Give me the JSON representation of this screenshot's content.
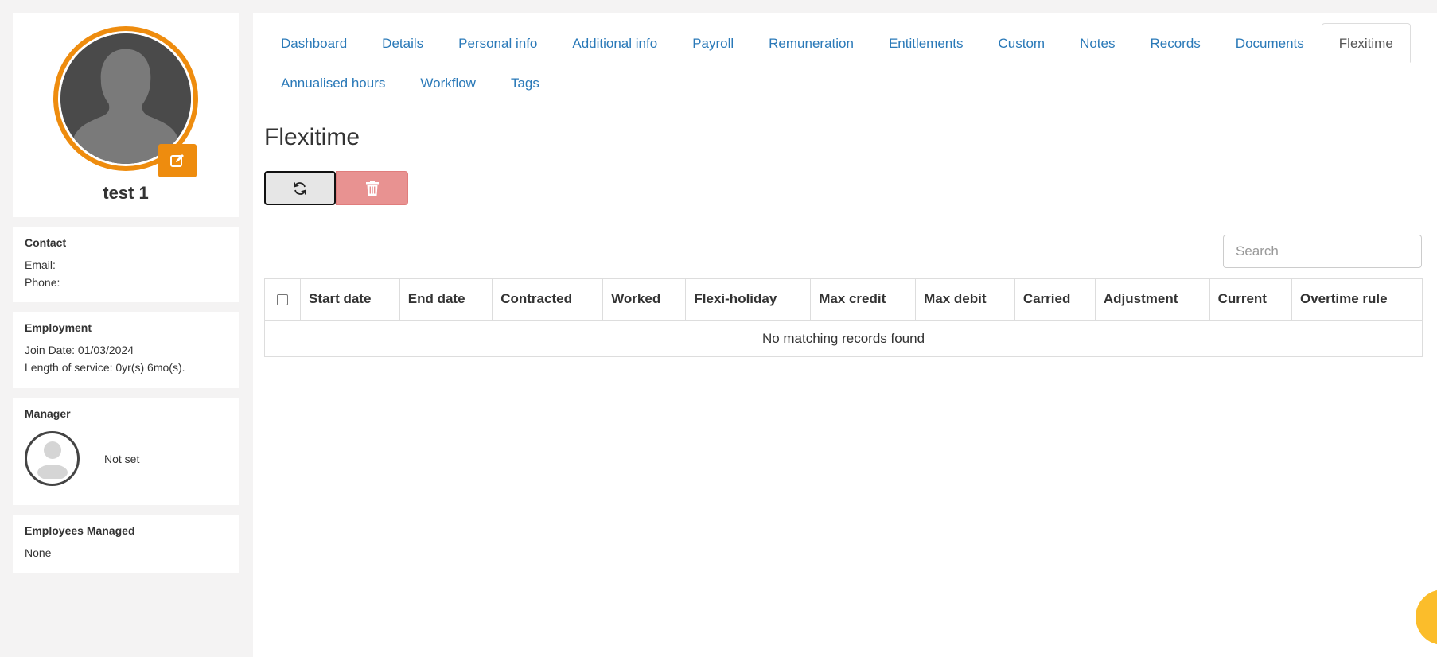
{
  "profile": {
    "name": "test 1"
  },
  "contact": {
    "title": "Contact",
    "email_label": "Email:",
    "phone_label": "Phone:"
  },
  "employment": {
    "title": "Employment",
    "join_date": "Join Date: 01/03/2024",
    "length_of_service": "Length of service: 0yr(s) 6mo(s)."
  },
  "manager": {
    "title": "Manager",
    "name": "Not set"
  },
  "employees_managed": {
    "title": "Employees Managed",
    "value": "None"
  },
  "tabs": [
    {
      "label": "Dashboard",
      "active": false
    },
    {
      "label": "Details",
      "active": false
    },
    {
      "label": "Personal info",
      "active": false
    },
    {
      "label": "Additional info",
      "active": false
    },
    {
      "label": "Payroll",
      "active": false
    },
    {
      "label": "Remuneration",
      "active": false
    },
    {
      "label": "Entitlements",
      "active": false
    },
    {
      "label": "Custom",
      "active": false
    },
    {
      "label": "Notes",
      "active": false
    },
    {
      "label": "Records",
      "active": false
    },
    {
      "label": "Documents",
      "active": false
    },
    {
      "label": "Flexitime",
      "active": true
    },
    {
      "label": "Annualised hours",
      "active": false
    },
    {
      "label": "Workflow",
      "active": false
    },
    {
      "label": "Tags",
      "active": false
    }
  ],
  "page": {
    "title": "Flexitime"
  },
  "toolbar": {
    "refresh_icon": "refresh-icon",
    "delete_icon": "trash-icon"
  },
  "search": {
    "placeholder": "Search"
  },
  "table": {
    "columns": [
      "Start date",
      "End date",
      "Contracted",
      "Worked",
      "Flexi-holiday",
      "Max credit",
      "Max debit",
      "Carried",
      "Adjustment",
      "Current",
      "Overtime rule"
    ],
    "empty_message": "No matching records found"
  },
  "colors": {
    "accent": "#ee8c0e",
    "link": "#2a79b8",
    "danger": "#e89291",
    "fab": "#fbbd2b"
  }
}
